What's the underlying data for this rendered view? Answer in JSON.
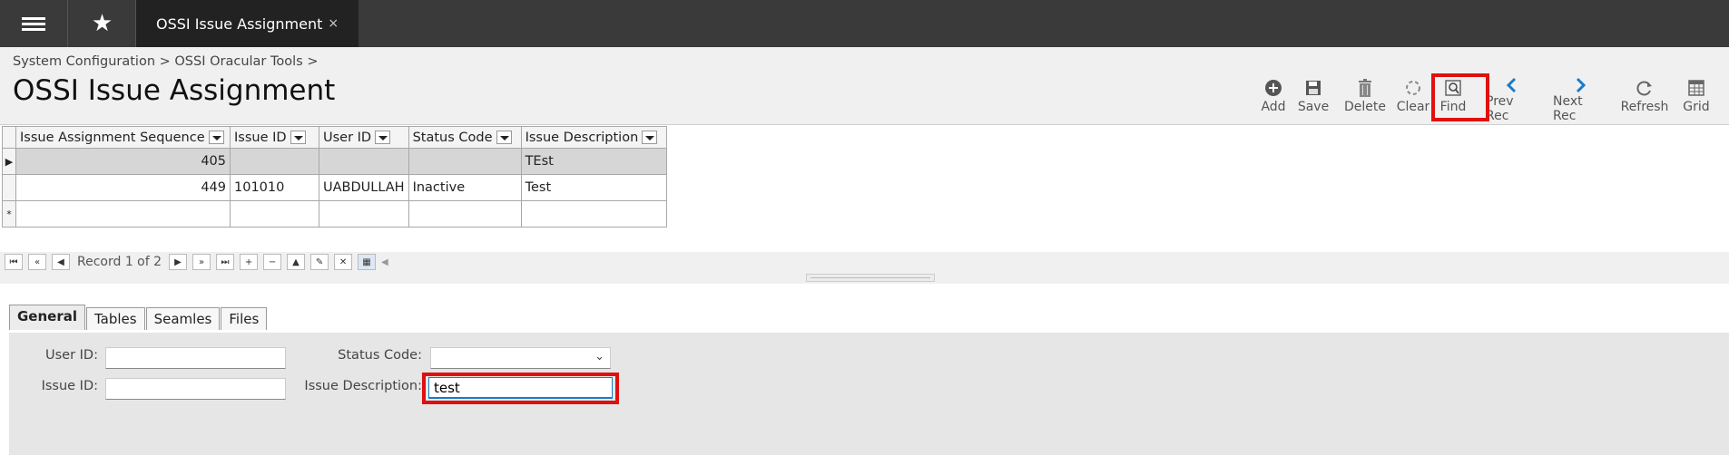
{
  "header": {
    "tab_title": "OSSI Issue Assignment",
    "tab_close": "×"
  },
  "breadcrumb": "System Configuration > OSSI Oracular Tools >",
  "page_title": "OSSI Issue Assignment",
  "toolbar": {
    "add": "Add",
    "save": "Save",
    "delete": "Delete",
    "clear": "Clear",
    "find": "Find",
    "prev": "Prev Rec",
    "next": "Next Rec",
    "refresh": "Refresh",
    "grid": "Grid"
  },
  "grid": {
    "columns": [
      "Issue Assignment Sequence",
      "Issue ID",
      "User ID",
      "Status Code",
      "Issue Description"
    ],
    "rows": [
      {
        "seq": "405",
        "issue_id": "",
        "user_id": "",
        "status": "",
        "desc": "TEst"
      },
      {
        "seq": "449",
        "issue_id": "101010",
        "user_id": "UABDULLAH",
        "status": "Inactive",
        "desc": "Test"
      }
    ]
  },
  "navigator": {
    "record_label": "Record 1 of 2"
  },
  "tabs": [
    "General",
    "Tables",
    "Seamles",
    "Files"
  ],
  "form": {
    "user_id_label": "User ID:",
    "issue_id_label": "Issue ID:",
    "status_code_label": "Status Code:",
    "issue_desc_label": "Issue Description:",
    "user_id_value": "",
    "issue_id_value": "",
    "status_code_value": "",
    "issue_desc_value": "test"
  },
  "colors": {
    "highlight": "#e01010",
    "accent": "#1a7cc9"
  }
}
